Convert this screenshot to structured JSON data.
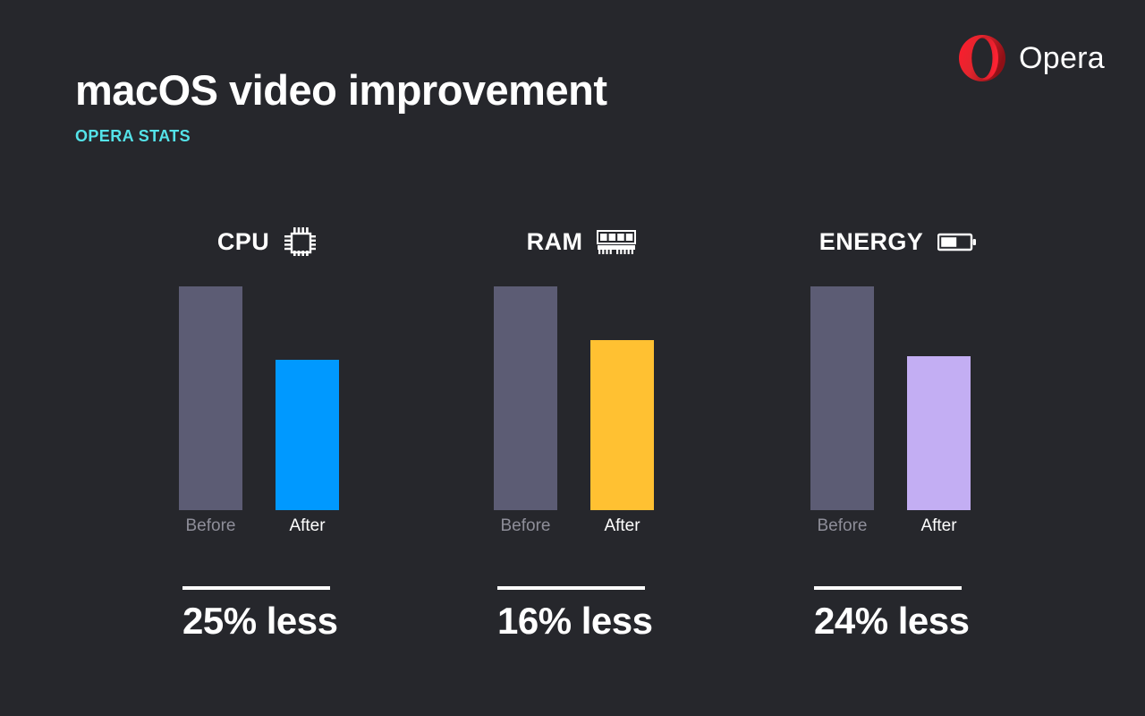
{
  "background_color": "#26272c",
  "header": {
    "title": "macOS video improvement",
    "subtitle": "OPERA STATS",
    "subtitle_color": "#54e2e8"
  },
  "brand": {
    "name": "Opera",
    "logo_icon": "opera-o-icon",
    "logo_color": "#e3262e",
    "logo_color_dark": "#8f1016"
  },
  "chart_data": {
    "type": "bar",
    "title": "macOS video improvement",
    "subtitle": "OPERA STATS",
    "categories": [
      "Before",
      "After"
    ],
    "groups": [
      {
        "name": "CPU",
        "icon": "cpu-chip-icon",
        "before_label": "Before",
        "after_label": "After",
        "before_value": 100,
        "after_value": 75,
        "before_color": "#5c5c74",
        "after_color": "#0099ff",
        "result": "25% less"
      },
      {
        "name": "RAM",
        "icon": "ram-stick-icon",
        "before_label": "Before",
        "after_label": "After",
        "before_value": 100,
        "after_value": 84,
        "before_color": "#5c5c74",
        "after_color": "#ffc132",
        "result": "16% less"
      },
      {
        "name": "ENERGY",
        "icon": "battery-icon",
        "before_label": "Before",
        "after_label": "After",
        "before_value": 100,
        "after_value": 76,
        "before_color": "#5c5c74",
        "after_color": "#c3aef3",
        "result": "24% less"
      }
    ],
    "ylabel": "",
    "xlabel": "",
    "ylim": [
      0,
      100
    ],
    "grid": false,
    "legend": "none",
    "value_unit": "relative %"
  }
}
